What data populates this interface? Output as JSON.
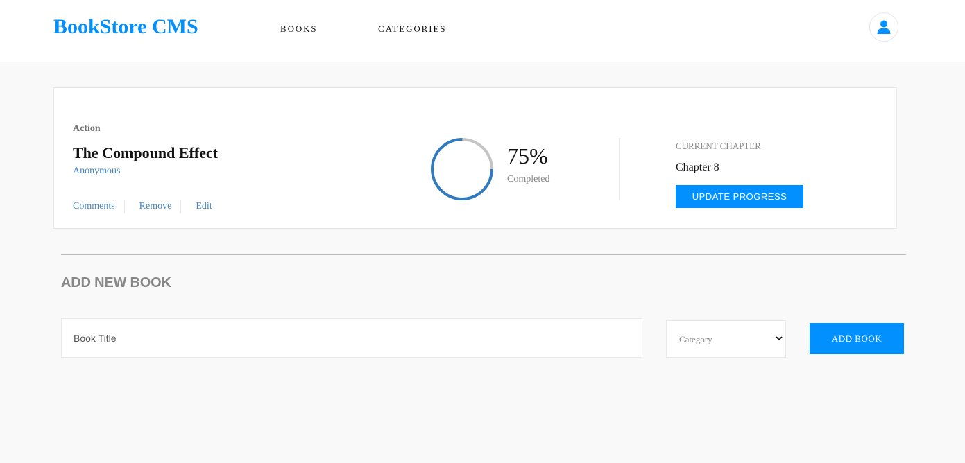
{
  "header": {
    "brand": "BookStore CMS",
    "nav": [
      "BOOKS",
      "CATEGORIES"
    ],
    "user_icon": "user-icon"
  },
  "book": {
    "genre": "Action",
    "title": "The Compound Effect",
    "author": "Anonymous",
    "actions": [
      "Comments",
      "Remove",
      "Edit"
    ],
    "progress_percent": 75,
    "percent_label": "75%",
    "completed_label": "Completed",
    "chapter_heading": "CURRENT CHAPTER",
    "chapter": "Chapter 8",
    "update_label": "UPDATE PROGRESS"
  },
  "form": {
    "heading": "ADD NEW BOOK",
    "title_placeholder": "Book Title",
    "category_placeholder": "Category",
    "submit_label": "ADD BOOK"
  },
  "colors": {
    "accent": "#0290ff",
    "link": "#4386bf",
    "progress": "#307bbe",
    "progress_track": "#e8e8e8"
  }
}
